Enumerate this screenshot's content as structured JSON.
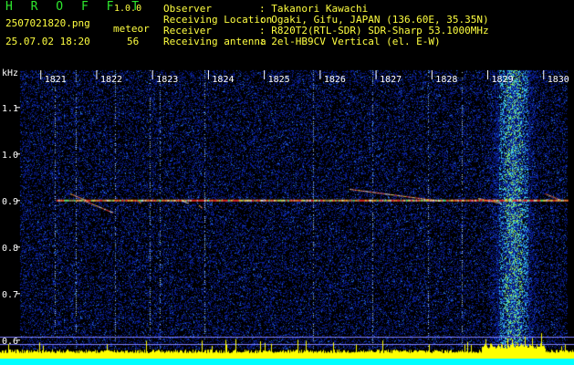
{
  "header": {
    "app_title": "H R O F F T",
    "version": "1.0.0",
    "file_name": "2507021820.png",
    "datetime": "25.07.02 18:20",
    "meteor_label": "meteor",
    "meteor_count": "56",
    "info": [
      {
        "label": "Observer",
        "value": ": Takanori Kawachi"
      },
      {
        "label": "Receiving Location",
        "value": ": Ogaki, Gifu, JAPAN (136.60E, 35.35N)"
      },
      {
        "label": "Receiver",
        "value": ": R820T2(RTL-SDR) SDR-Sharp 53.1000MHz"
      },
      {
        "label": "Receiving antenna",
        "value": ": 2el-HB9CV Vertical (el. E-W)"
      }
    ]
  },
  "colors": {
    "background": "#000000",
    "header_text": "#ffff40",
    "title": "#2ee82e",
    "noise": "#0a1a8c",
    "carrier": "#ff3020",
    "signal_bar": "#ffff00",
    "baseline": "#00ffff"
  },
  "chart_data": {
    "type": "heatmap",
    "ylabel": "kHz",
    "yticks": [
      "1.1",
      "1.0",
      "0.9",
      "0.8",
      "0.7",
      "0.6"
    ],
    "ytick_values": [
      1.1,
      1.0,
      0.9,
      0.8,
      0.7,
      0.6
    ],
    "ylim": [
      0.58,
      1.18
    ],
    "xticks": [
      "1821",
      "1822",
      "1823",
      "1824",
      "1825",
      "1826",
      "1827",
      "1828",
      "1829",
      "1830"
    ],
    "xtick_minutes": [
      1,
      2,
      3,
      4,
      5,
      6,
      7,
      8,
      9,
      10
    ],
    "xlim_minutes": [
      0.4,
      10.2
    ],
    "carrier_khz": 0.9,
    "meteor_echoes": [
      {
        "t": 1.3,
        "f_start": 0.915,
        "f_end": 0.9,
        "dur": 0.3
      },
      {
        "t": 1.55,
        "f_start": 0.9,
        "f_end": 0.875,
        "dur": 0.5
      },
      {
        "t": 2.5,
        "f_start": 0.9,
        "f_end": 0.895,
        "dur": 0.05
      },
      {
        "t": 3.3,
        "f_start": 0.9,
        "f_end": 0.895,
        "dur": 0.1
      },
      {
        "t": 3.6,
        "f_start": 0.89,
        "f_end": 0.885,
        "dur": 0.05
      },
      {
        "t": 6.3,
        "f_start": 0.925,
        "f_end": 0.9,
        "dur": 1.6
      },
      {
        "t": 8.6,
        "f_start": 0.905,
        "f_end": 0.895,
        "dur": 0.4
      },
      {
        "t": 9.8,
        "f_start": 0.915,
        "f_end": 0.9,
        "dur": 0.3
      }
    ],
    "vertical_streaks_minutes": [
      1.02,
      1.4,
      2.1,
      2.72,
      2.9,
      3.7,
      5.65,
      6.7,
      7.7,
      8.3
    ],
    "strong_noise_band_minutes": [
      8.9,
      9.55
    ]
  }
}
